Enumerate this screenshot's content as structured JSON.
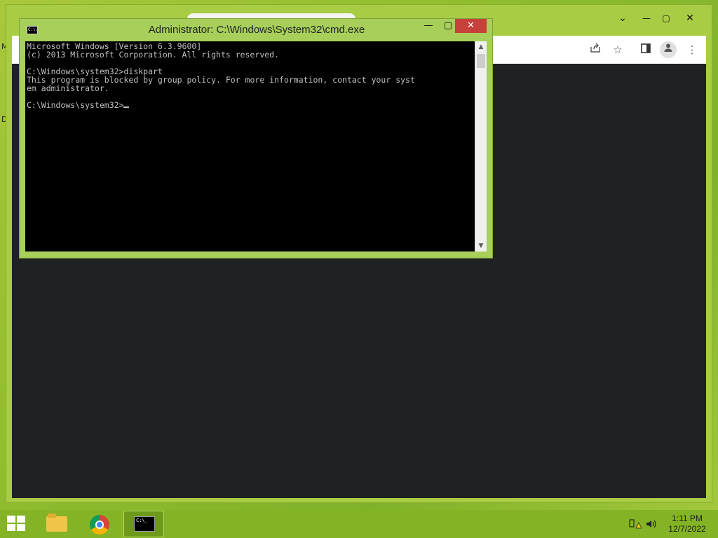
{
  "desktop": {
    "fragments": [
      "M",
      "D"
    ]
  },
  "browser": {
    "window_controls": {
      "chevron": "⌄",
      "minimize": "—",
      "maximize": "▢",
      "close": "✕"
    },
    "toolbar_icons": [
      "share-icon",
      "star-icon",
      "sidebar-icon",
      "profile-icon",
      "more-icon"
    ]
  },
  "cmd_window": {
    "title": "Administrator: C:\\Windows\\System32\\cmd.exe",
    "icon_text": "C:\\.",
    "buttons": {
      "minimize": "—",
      "maximize": "▢",
      "close": "✕"
    },
    "console_lines": [
      "Microsoft Windows [Version 6.3.9600]",
      "(c) 2013 Microsoft Corporation. All rights reserved.",
      "",
      "C:\\Windows\\system32>diskpart",
      "This program is blocked by group policy. For more information, contact your syst",
      "em administrator.",
      "",
      "C:\\Windows\\system32>"
    ]
  },
  "taskbar": {
    "apps": [
      {
        "name": "File Explorer",
        "active": false
      },
      {
        "name": "Google Chrome",
        "active": false
      },
      {
        "name": "Command Prompt",
        "active": true
      }
    ],
    "cmd_icon_text": "C:\\_",
    "clock": {
      "time": "1:11 PM",
      "date": "12/7/2022"
    }
  },
  "colors": {
    "desktop_bg": "#8fbc2e",
    "window_frame": "#a7cf5a",
    "close_button": "#c8403a",
    "console_bg": "#000000",
    "console_fg": "#c0c0c0",
    "browser_content": "#202124"
  }
}
